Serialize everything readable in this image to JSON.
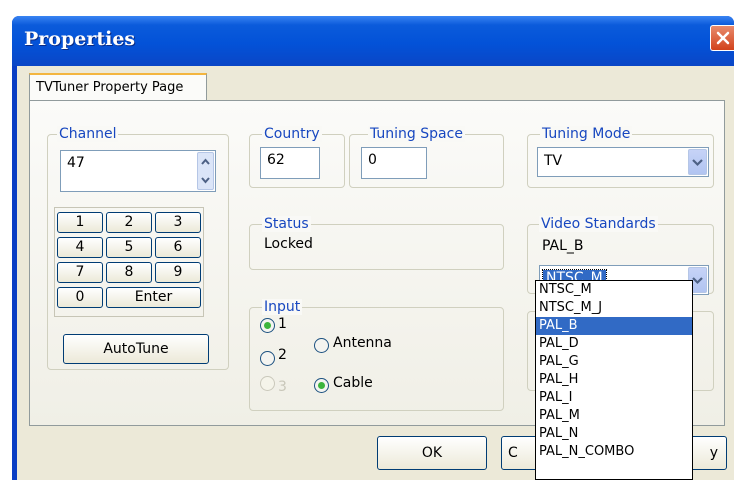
{
  "window": {
    "title": "Properties"
  },
  "tab": {
    "label": "TVTuner Property Page"
  },
  "channel": {
    "legend": "Channel",
    "value": "47",
    "keypad": [
      "1",
      "2",
      "3",
      "4",
      "5",
      "6",
      "7",
      "8",
      "9",
      "0"
    ],
    "enter_label": "Enter",
    "autotune_label": "AutoTune"
  },
  "country": {
    "legend": "Country",
    "value": "62"
  },
  "tuning_space": {
    "legend": "Tuning Space",
    "value": "0"
  },
  "tuning_mode": {
    "legend": "Tuning Mode",
    "value": "TV"
  },
  "status": {
    "legend": "Status",
    "value": "Locked"
  },
  "video_standards": {
    "legend": "Video Standards",
    "current": "PAL_B",
    "selected": "NTSC_M",
    "options": [
      "NTSC_M",
      "NTSC_M_J",
      "PAL_B",
      "PAL_D",
      "PAL_G",
      "PAL_H",
      "PAL_I",
      "PAL_M",
      "PAL_N",
      "PAL_N_COMBO"
    ],
    "highlighted_option": "PAL_B"
  },
  "input": {
    "legend": "Input",
    "options": [
      {
        "label": "1",
        "checked": true,
        "disabled": false
      },
      {
        "label": "2",
        "checked": false,
        "disabled": false
      },
      {
        "label": "3",
        "checked": false,
        "disabled": true
      }
    ],
    "type_options": [
      {
        "label": "Antenna",
        "checked": false
      },
      {
        "label": "Cable",
        "checked": true
      }
    ]
  },
  "footer": {
    "ok_label": "OK",
    "cancel_partial": "C",
    "apply_partial": "y"
  },
  "colors": {
    "title_bar": "#0352d8",
    "legend_text": "#1747c0",
    "selection": "#316ac5",
    "dialog_bg": "#ece9d8"
  }
}
